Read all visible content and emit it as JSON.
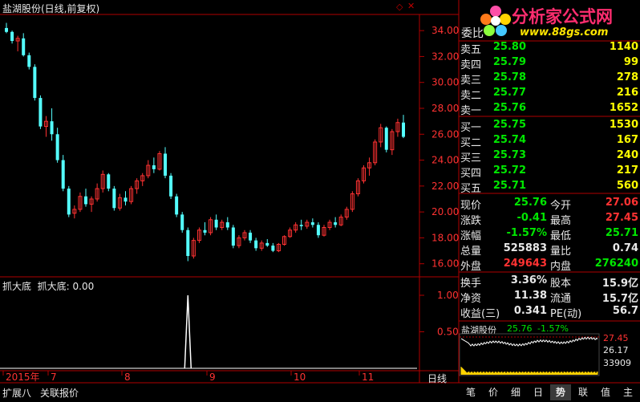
{
  "header": {
    "title": "盐湖股份(日线,前复权)",
    "logo_text": "分析家公式网",
    "logo_url": "www.88gs.com"
  },
  "price_axis": {
    "ticks": [
      "34.00",
      "32.00",
      "30.00",
      "28.00",
      "26.00",
      "24.00",
      "22.00",
      "20.00",
      "18.00",
      "16.00"
    ]
  },
  "indicator": {
    "title": "抓大底",
    "value_label": "抓大底: 0.00",
    "ticks": [
      "1.00",
      "0.50"
    ]
  },
  "time_axis": {
    "labels": [
      "2015年",
      "7",
      "8",
      "9",
      "10",
      "11"
    ]
  },
  "period_label": "日线",
  "order_book": {
    "header_label": "委比",
    "sells": [
      {
        "label": "卖五",
        "price": "25.80",
        "vol": "1140"
      },
      {
        "label": "卖四",
        "price": "25.79",
        "vol": "99"
      },
      {
        "label": "卖三",
        "price": "25.78",
        "vol": "278"
      },
      {
        "label": "卖二",
        "price": "25.77",
        "vol": "216"
      },
      {
        "label": "卖一",
        "price": "25.76",
        "vol": "1652"
      }
    ],
    "buys": [
      {
        "label": "买一",
        "price": "25.75",
        "vol": "1530"
      },
      {
        "label": "买二",
        "price": "25.74",
        "vol": "167"
      },
      {
        "label": "买三",
        "price": "25.73",
        "vol": "240"
      },
      {
        "label": "买四",
        "price": "25.72",
        "vol": "217"
      },
      {
        "label": "买五",
        "price": "25.71",
        "vol": "560"
      }
    ]
  },
  "quote": [
    {
      "l1": "现价",
      "v1": "25.76",
      "c1": "green",
      "l2": "今开",
      "v2": "27.06",
      "c2": "red"
    },
    {
      "l1": "涨跌",
      "v1": "-0.41",
      "c1": "green",
      "l2": "最高",
      "v2": "27.45",
      "c2": "red"
    },
    {
      "l1": "涨幅",
      "v1": "-1.57%",
      "c1": "green",
      "l2": "最低",
      "v2": "25.71",
      "c2": "green"
    },
    {
      "l1": "总量",
      "v1": "525883",
      "c1": "white",
      "l2": "量比",
      "v2": "0.74",
      "c2": "white"
    },
    {
      "l1": "外盘",
      "v1": "249643",
      "c1": "red",
      "l2": "内盘",
      "v2": "276240",
      "c2": "green"
    }
  ],
  "finance": [
    {
      "l1": "换手",
      "v1": "3.36%",
      "l2": "股本",
      "v2": "15.9亿"
    },
    {
      "l1": "净资",
      "v1": "11.38",
      "l2": "流通",
      "v2": "15.7亿"
    },
    {
      "l1": "收益(三)",
      "v1": "0.341",
      "l2": "PE(动)",
      "v2": "56.7"
    }
  ],
  "mini_chart": {
    "name": "盐湖股份",
    "price": "25.76",
    "change": "-1.57%",
    "high": "27.45",
    "mid": "26.17",
    "volume": "33909"
  },
  "bottom_tabs": [
    "扩展八",
    "关联报价"
  ],
  "right_tabs": [
    "笔",
    "价",
    "细",
    "日",
    "势",
    "联",
    "值",
    "主"
  ],
  "active_right_tab": "势",
  "colors": {
    "up": "#ff3232",
    "down": "#54ffff",
    "frame": "#b00000"
  },
  "chart_data": {
    "type": "candlestick",
    "yrange": [
      15.3,
      35.0
    ],
    "candles": [
      [
        34.2,
        34.6,
        33.8,
        33.9
      ],
      [
        33.9,
        34.0,
        33.0,
        33.2
      ],
      [
        33.2,
        33.6,
        32.4,
        33.4
      ],
      [
        33.4,
        33.8,
        32.0,
        32.1
      ],
      [
        32.1,
        32.3,
        31.0,
        31.2
      ],
      [
        31.2,
        31.4,
        28.6,
        28.8
      ],
      [
        28.8,
        29.0,
        26.4,
        26.6
      ],
      [
        26.6,
        27.4,
        25.8,
        27.0
      ],
      [
        27.0,
        28.0,
        25.5,
        26.0
      ],
      [
        26.0,
        26.5,
        23.8,
        24.0
      ],
      [
        24.0,
        24.4,
        21.6,
        21.8
      ],
      [
        21.8,
        22.0,
        19.6,
        19.8
      ],
      [
        19.9,
        20.5,
        19.5,
        20.2
      ],
      [
        20.2,
        21.5,
        20.0,
        21.2
      ],
      [
        21.2,
        21.8,
        20.4,
        20.6
      ],
      [
        20.6,
        21.2,
        20.0,
        21.0
      ],
      [
        21.0,
        22.2,
        20.8,
        21.8
      ],
      [
        21.8,
        23.2,
        21.5,
        22.9
      ],
      [
        22.9,
        23.0,
        21.6,
        21.8
      ],
      [
        21.8,
        22.0,
        20.1,
        20.3
      ],
      [
        20.3,
        21.4,
        20.1,
        21.1
      ],
      [
        21.1,
        21.6,
        20.5,
        20.8
      ],
      [
        20.8,
        22.0,
        20.6,
        21.8
      ],
      [
        21.8,
        22.6,
        21.4,
        22.4
      ],
      [
        22.4,
        23.0,
        22.0,
        22.8
      ],
      [
        22.8,
        24.0,
        22.6,
        23.6
      ],
      [
        23.6,
        24.2,
        23.0,
        23.3
      ],
      [
        23.3,
        24.7,
        23.2,
        24.5
      ],
      [
        24.5,
        25.0,
        22.6,
        22.8
      ],
      [
        22.8,
        23.0,
        21.0,
        21.2
      ],
      [
        21.2,
        21.4,
        19.6,
        19.8
      ],
      [
        19.8,
        20.0,
        18.4,
        18.6
      ],
      [
        18.6,
        18.8,
        16.2,
        16.6
      ],
      [
        16.6,
        18.0,
        16.4,
        17.8
      ],
      [
        17.8,
        18.8,
        17.6,
        18.6
      ],
      [
        18.6,
        19.2,
        18.2,
        18.4
      ],
      [
        18.4,
        19.6,
        18.2,
        19.4
      ],
      [
        19.4,
        19.8,
        18.6,
        18.8
      ],
      [
        18.8,
        19.4,
        18.6,
        19.2
      ],
      [
        19.2,
        19.6,
        18.6,
        18.8
      ],
      [
        18.8,
        19.0,
        17.2,
        17.4
      ],
      [
        17.4,
        18.2,
        17.2,
        18.0
      ],
      [
        18.0,
        18.6,
        17.8,
        18.4
      ],
      [
        18.4,
        18.6,
        17.6,
        17.8
      ],
      [
        17.8,
        18.0,
        17.0,
        17.2
      ],
      [
        17.2,
        17.8,
        17.0,
        17.6
      ],
      [
        17.6,
        17.9,
        17.3,
        17.4
      ],
      [
        17.4,
        17.6,
        16.9,
        17.0
      ],
      [
        17.0,
        17.6,
        16.9,
        17.5
      ],
      [
        17.5,
        18.2,
        17.4,
        18.1
      ],
      [
        18.1,
        18.8,
        18.0,
        18.6
      ],
      [
        18.6,
        19.2,
        18.4,
        19.0
      ],
      [
        19.0,
        19.4,
        18.6,
        18.9
      ],
      [
        18.9,
        19.4,
        18.7,
        19.2
      ],
      [
        19.2,
        19.5,
        18.8,
        19.0
      ],
      [
        19.0,
        19.2,
        18.0,
        18.2
      ],
      [
        18.2,
        19.0,
        18.1,
        18.8
      ],
      [
        18.8,
        19.4,
        18.6,
        19.2
      ],
      [
        19.2,
        19.6,
        18.8,
        19.0
      ],
      [
        19.0,
        19.8,
        18.9,
        19.6
      ],
      [
        19.6,
        20.4,
        19.4,
        20.2
      ],
      [
        20.2,
        21.6,
        20.0,
        21.4
      ],
      [
        21.4,
        22.6,
        21.2,
        22.4
      ],
      [
        22.4,
        23.6,
        22.2,
        23.4
      ],
      [
        23.4,
        24.2,
        22.8,
        23.8
      ],
      [
        23.8,
        25.6,
        23.6,
        25.4
      ],
      [
        25.4,
        26.8,
        25.0,
        26.5
      ],
      [
        26.5,
        26.6,
        24.6,
        24.8
      ],
      [
        24.8,
        26.4,
        24.4,
        26.2
      ],
      [
        26.2,
        27.2,
        25.8,
        26.9
      ],
      [
        26.9,
        27.5,
        25.7,
        25.8
      ]
    ]
  }
}
